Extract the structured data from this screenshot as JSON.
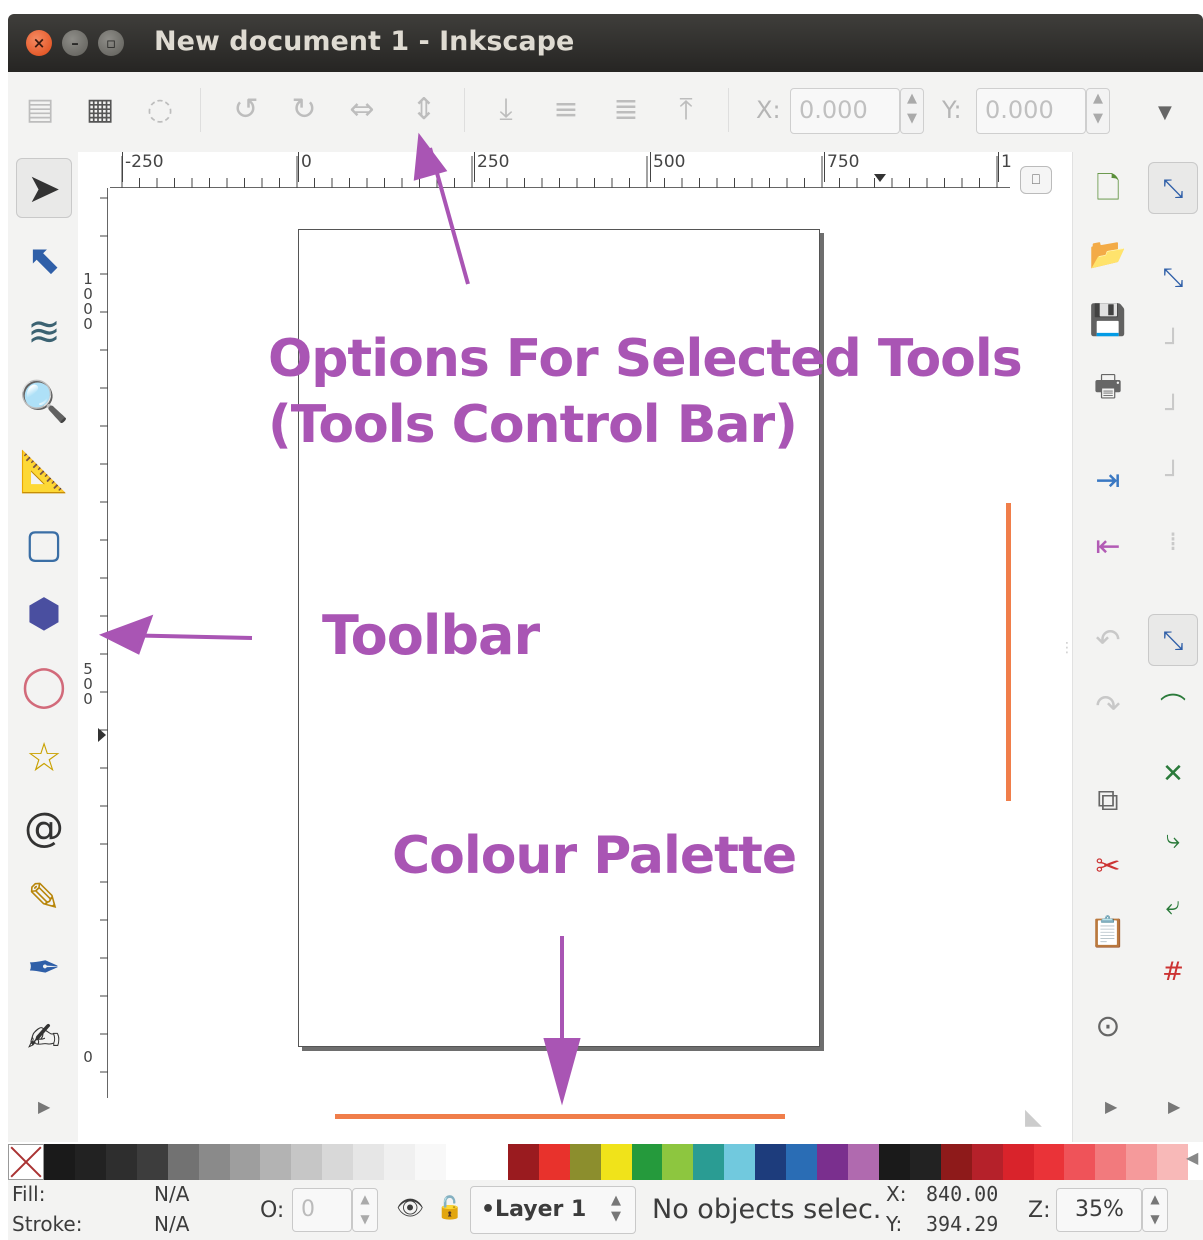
{
  "window": {
    "title": "New document 1 - Inkscape",
    "close": "×",
    "minimize": "–",
    "maximize": "▫"
  },
  "controls": {
    "x_label": "X:",
    "x_value": "0.000",
    "y_label": "Y:",
    "y_value": "0.000"
  },
  "rulers": {
    "horizontal": [
      "-250",
      "0",
      "250",
      "500",
      "750",
      "1"
    ],
    "vertical": [
      "1\n0\n0\n0",
      "5\n0\n0",
      "0"
    ]
  },
  "tools": [
    {
      "icon": "selector-icon",
      "glyph": "➤"
    },
    {
      "icon": "node-editor-icon",
      "glyph": "⬉"
    },
    {
      "icon": "tweak-icon",
      "glyph": "≋"
    },
    {
      "icon": "zoom-icon",
      "glyph": "🔍"
    },
    {
      "icon": "measure-icon",
      "glyph": "📐"
    },
    {
      "icon": "rectangle-icon",
      "glyph": "▢"
    },
    {
      "icon": "3d-box-icon",
      "glyph": "⬢"
    },
    {
      "icon": "ellipse-icon",
      "glyph": "◯"
    },
    {
      "icon": "star-icon",
      "glyph": "☆"
    },
    {
      "icon": "spiral-icon",
      "glyph": "@"
    },
    {
      "icon": "pencil-icon",
      "glyph": "✎"
    },
    {
      "icon": "pen-icon",
      "glyph": "✒"
    },
    {
      "icon": "calligraphy-icon",
      "glyph": "✍"
    }
  ],
  "annotations": {
    "options_line1": "Options For Selected Tools",
    "options_line2": "(Tools Control Bar)",
    "toolbar": "Toolbar",
    "palette": "Colour Palette"
  },
  "palette_colors": [
    "#1a1a1a",
    "#222222",
    "#2e2e2e",
    "#3d3d3d",
    "#727272",
    "#8a8a8a",
    "#9e9e9e",
    "#b3b3b3",
    "#c6c6c6",
    "#d8d8d8",
    "#e6e6e6",
    "#f0f0f0",
    "#f8f8f8",
    "#ffffff",
    "#ffffff",
    "#9a1b1f",
    "#e8322c",
    "#8c8e2d",
    "#f0e31a",
    "#259a3c",
    "#8dc63f",
    "#2a9c93",
    "#71c9de",
    "#1d3c7c",
    "#2a6db5",
    "#7a2f8e",
    "#b06aaf",
    "#1a1a1a",
    "#222222",
    "#8e1a1a",
    "#b5212a",
    "#d9232b",
    "#ea3338",
    "#ef5359",
    "#f27a7d",
    "#f59a9b",
    "#f8b9b8"
  ],
  "status": {
    "fill_label": "Fill:",
    "fill_value": "N/A",
    "stroke_label": "Stroke:",
    "stroke_value": "N/A",
    "opacity_label": "O:",
    "opacity_value": "0",
    "layer": "•Layer 1",
    "message": "No objects selec.",
    "cursor_x_label": "X:",
    "cursor_x": "840.00",
    "cursor_y_label": "Y:",
    "cursor_y": "394.29",
    "zoom_label": "Z:",
    "zoom": "35%"
  }
}
